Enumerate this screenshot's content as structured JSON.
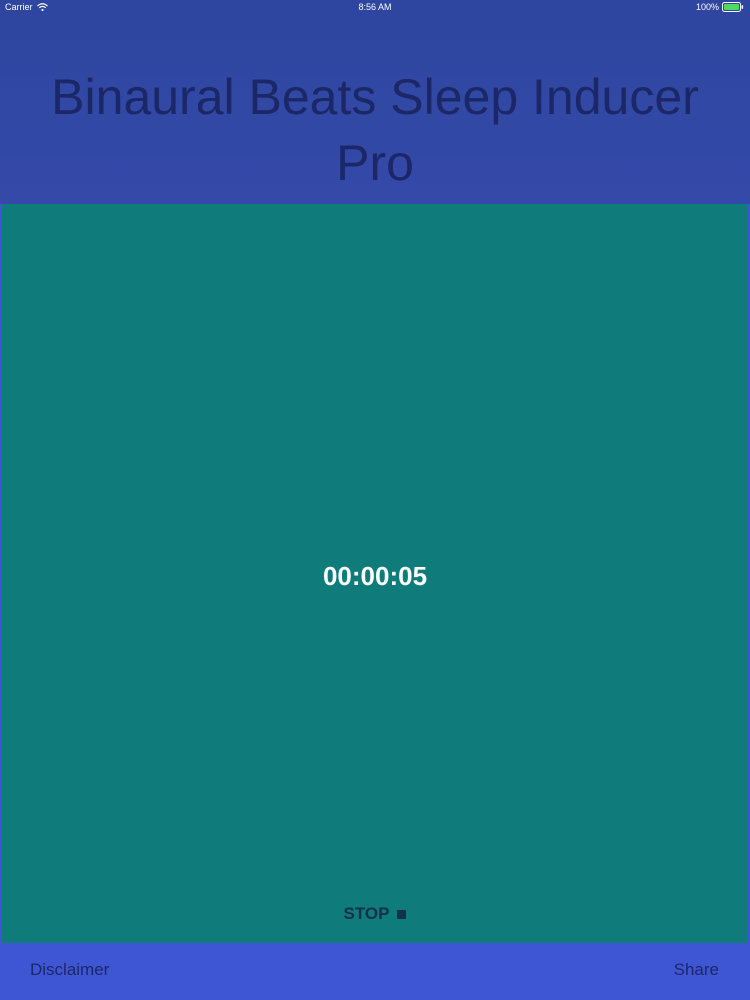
{
  "status_bar": {
    "carrier": "Carrier",
    "wifi_icon": "wifi-icon",
    "time": "8:56 AM",
    "battery_percent": "100%",
    "battery_icon": "battery-icon",
    "battery_color": "#4cd964"
  },
  "header": {
    "title": "Binaural Beats Sleep Inducer Pro"
  },
  "player": {
    "timer": "00:00:05",
    "stop_label": "STOP",
    "stop_icon": "stop-square-icon"
  },
  "footer": {
    "disclaimer_label": "Disclaimer",
    "share_label": "Share"
  },
  "colors": {
    "header_background": "#3449a9",
    "panel_background": "#107b7b",
    "footer_background": "#3f56d4",
    "title_text": "#1c2768"
  }
}
